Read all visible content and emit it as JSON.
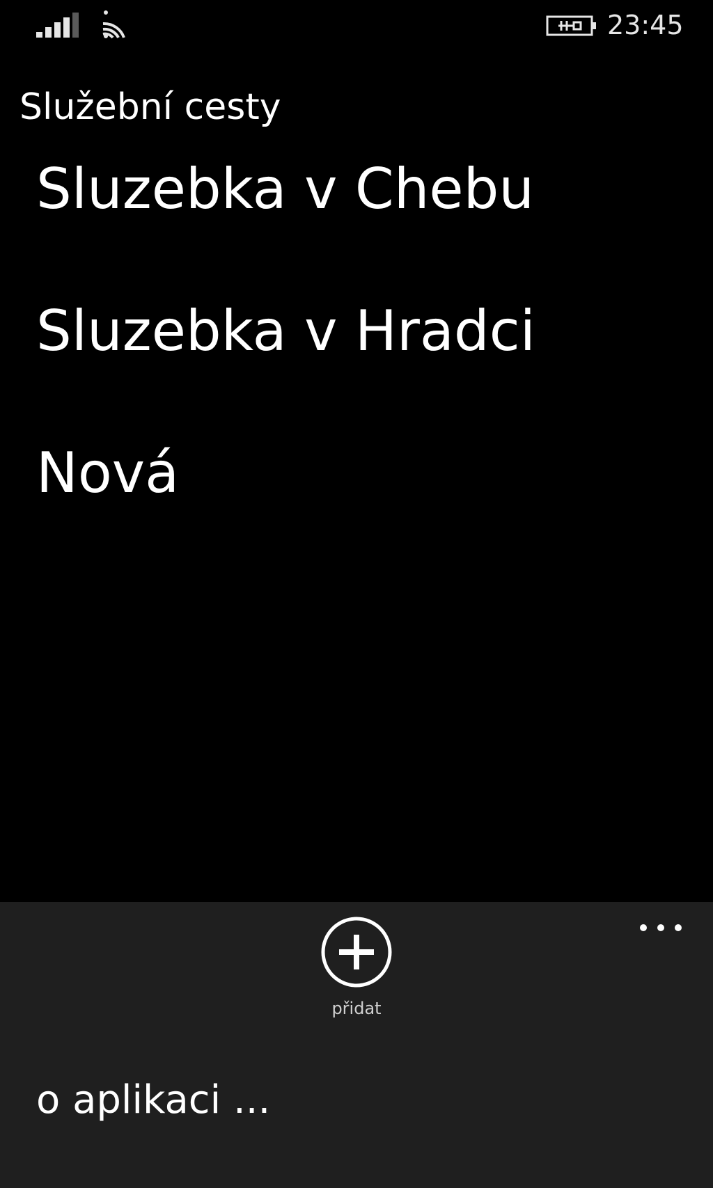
{
  "status_bar": {
    "clock": "23:45",
    "icons": [
      "signal-icon",
      "wifi-icon",
      "battery-charging-icon"
    ]
  },
  "page": {
    "title": "Služební cesty"
  },
  "trips": [
    {
      "name": "Sluzebka v Chebu"
    },
    {
      "name": "Sluzebka v Hradci"
    },
    {
      "name": "Nová"
    }
  ],
  "app_bar": {
    "add_label": "přidat",
    "add_icon": "plus-circle-icon",
    "more_icon": "ellipsis-icon",
    "menu_items": [
      {
        "label": "o aplikaci ..."
      }
    ],
    "background": "#1f1f1f"
  },
  "colors": {
    "background": "#000000",
    "foreground": "#ffffff"
  }
}
